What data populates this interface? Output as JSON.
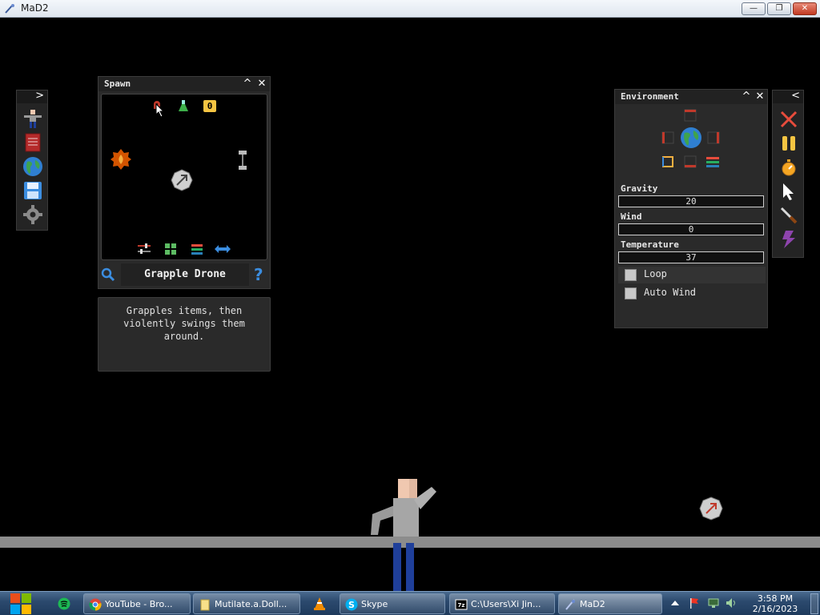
{
  "window": {
    "title": "MaD2",
    "min_label": "—",
    "max_label": "❐",
    "close_label": "✕"
  },
  "spawn": {
    "title": "Spawn",
    "selected_name": "Grapple Drone",
    "description": "Grapples items, then\nviolently swings them\naround.",
    "badge": "0",
    "help_glyph": "?",
    "collapse_glyph": "^",
    "close_glyph": "✕"
  },
  "environment": {
    "title": "Environment",
    "collapse_glyph": "^",
    "close_glyph": "✕",
    "gravity_label": "Gravity",
    "gravity_value": "20",
    "wind_label": "Wind",
    "wind_value": "0",
    "temperature_label": "Temperature",
    "temperature_value": "37",
    "loop_label": "Loop",
    "auto_wind_label": "Auto Wind"
  },
  "left_toolbar": {
    "expand_glyph": ">"
  },
  "right_toolbar": {
    "collapse_glyph": "<"
  },
  "taskbar": {
    "items": [
      {
        "label": "YouTube - Bro...",
        "icon": "chrome-icon"
      },
      {
        "label": "Mutilate.a.Doll...",
        "icon": "folder-icon"
      },
      {
        "label": "Skype",
        "icon": "skype-icon"
      },
      {
        "label": "C:\\Users\\Xi Jin...",
        "icon": "7zip-icon"
      },
      {
        "label": "MaD2",
        "icon": "mad2-icon"
      }
    ],
    "time": "3:58 PM",
    "date": "2/16/2023"
  }
}
